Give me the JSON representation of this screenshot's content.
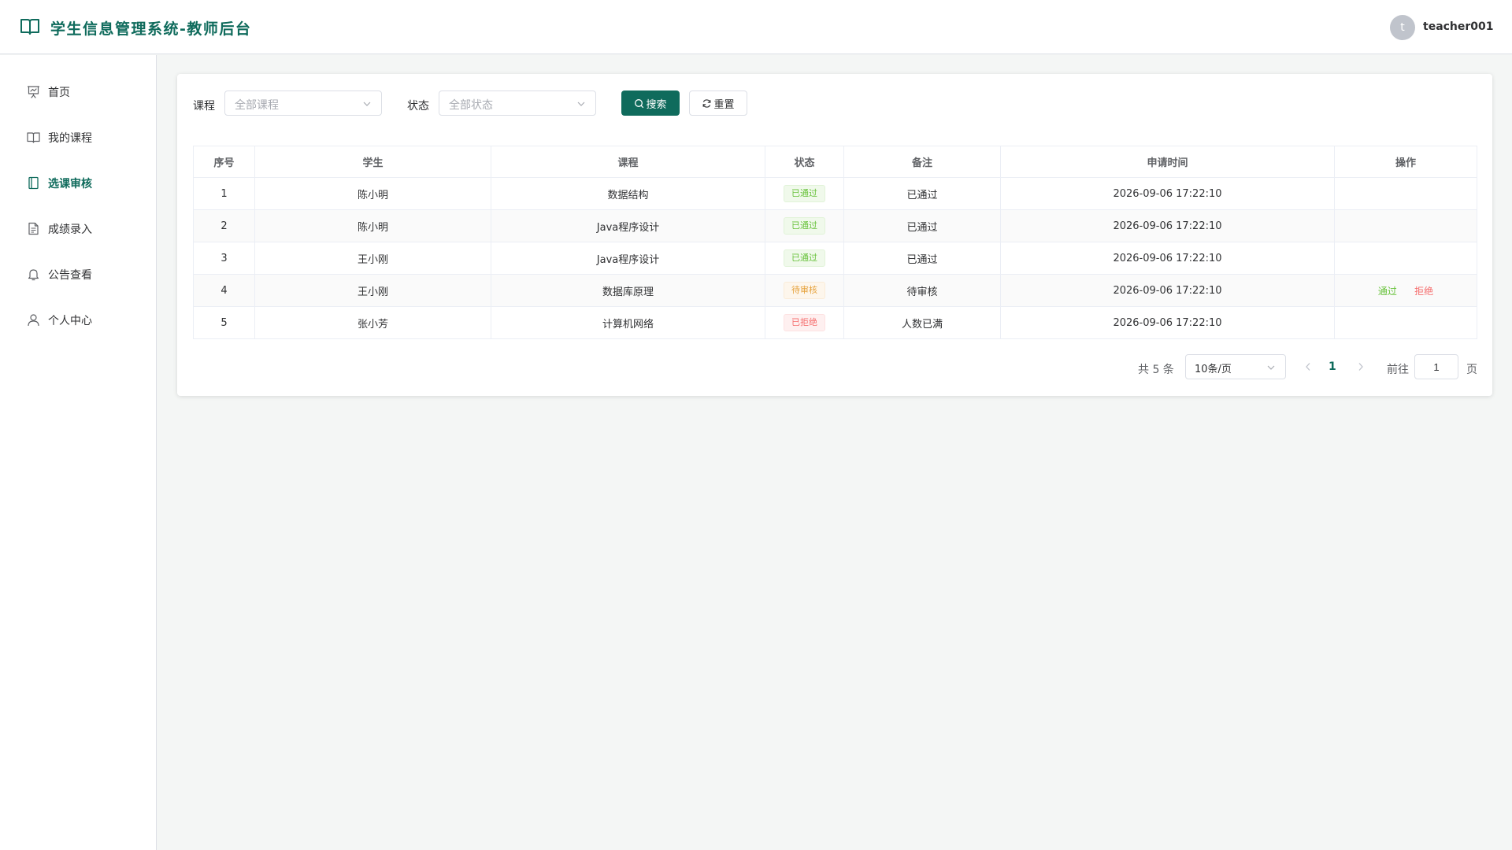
{
  "colors": {
    "brand": "#0f6b5c",
    "success": "#67c23a",
    "warning": "#e6a23c",
    "danger": "#f56c6c"
  },
  "header": {
    "logo_icon": "open-book-icon",
    "title": "学生信息管理系统-教师后台",
    "avatar_initial": "t",
    "username": "teacher001"
  },
  "sidebar": {
    "items": [
      {
        "label": "首页",
        "icon": "presentation-icon",
        "active": false
      },
      {
        "label": "我的课程",
        "icon": "book-icon",
        "active": false
      },
      {
        "label": "选课审核",
        "icon": "notebook-icon",
        "active": true
      },
      {
        "label": "成绩录入",
        "icon": "document-icon",
        "active": false
      },
      {
        "label": "公告查看",
        "icon": "bell-icon",
        "active": false
      },
      {
        "label": "个人中心",
        "icon": "user-icon",
        "active": false
      }
    ]
  },
  "filters": {
    "course_label": "课程",
    "course_placeholder": "全部课程",
    "status_label": "状态",
    "status_placeholder": "全部状态",
    "search_button": "搜索",
    "reset_button": "重置"
  },
  "table": {
    "headers": [
      "序号",
      "学生",
      "课程",
      "状态",
      "备注",
      "申请时间",
      "操作"
    ],
    "rows": [
      {
        "index": "1",
        "student": "陈小明",
        "course": "数据结构",
        "status": "已通过",
        "status_type": "pass",
        "remark": "已通过",
        "time": "2026-09-06 17:22:10",
        "actions": []
      },
      {
        "index": "2",
        "student": "陈小明",
        "course": "Java程序设计",
        "status": "已通过",
        "status_type": "pass",
        "remark": "已通过",
        "time": "2026-09-06 17:22:10",
        "actions": []
      },
      {
        "index": "3",
        "student": "王小刚",
        "course": "Java程序设计",
        "status": "已通过",
        "status_type": "pass",
        "remark": "已通过",
        "time": "2026-09-06 17:22:10",
        "actions": []
      },
      {
        "index": "4",
        "student": "王小刚",
        "course": "数据库原理",
        "status": "待审核",
        "status_type": "pending",
        "remark": "待审核",
        "time": "2026-09-06 17:22:10",
        "actions": [
          "通过",
          "拒绝"
        ]
      },
      {
        "index": "5",
        "student": "张小芳",
        "course": "计算机网络",
        "status": "已拒绝",
        "status_type": "reject",
        "remark": "人数已满",
        "time": "2026-09-06 17:22:10",
        "actions": []
      }
    ]
  },
  "pagination": {
    "total_text": "共 5 条",
    "page_size": "10条/页",
    "current_page": "1",
    "goto_label": "前往",
    "goto_value": "1",
    "page_suffix": "页"
  }
}
